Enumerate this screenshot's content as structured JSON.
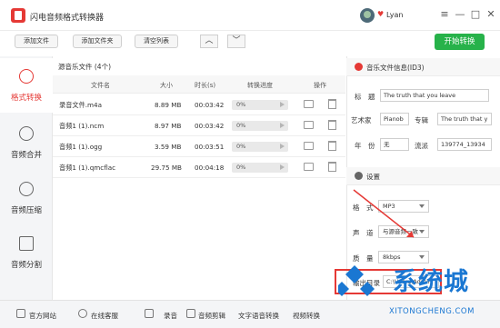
{
  "app": {
    "title": "闪电音频格式转换器",
    "user_name": "Lyan"
  },
  "window_controls": {
    "menu": "≡",
    "minimize": "—",
    "maximize": "□",
    "close": "✕"
  },
  "toolbar": {
    "add_file": "添加文件",
    "add_folder": "添加文件夹",
    "clear_list": "清空列表",
    "up": "︿",
    "down": "﹀",
    "start": "开始转换"
  },
  "nav": [
    {
      "label": "格式转换",
      "icon": "refresh-icon",
      "active": true
    },
    {
      "label": "音频合并",
      "icon": "merge-icon",
      "active": false
    },
    {
      "label": "音频压缩",
      "icon": "compress-icon",
      "active": false
    },
    {
      "label": "音频分割",
      "icon": "split-icon",
      "active": false
    }
  ],
  "files": {
    "title": "源音乐文件 (4个)",
    "columns": [
      "文件名",
      "大小",
      "时长(s)",
      "转换进度",
      "操作"
    ],
    "rows": [
      {
        "name": "录音文件.m4a",
        "size": "8.89 MB",
        "duration": "00:03:42",
        "progress": "0%"
      },
      {
        "name": "音频1 (1).ncm",
        "size": "8.97 MB",
        "duration": "00:03:42",
        "progress": "0%"
      },
      {
        "name": "音频1 (1).ogg",
        "size": "3.59 MB",
        "duration": "00:03:51",
        "progress": "0%"
      },
      {
        "name": "音频1 (1).qmcflac",
        "size": "29.75 MB",
        "duration": "00:04:18",
        "progress": "0%"
      }
    ]
  },
  "id3": {
    "title": "音乐文件信息(ID3)",
    "title_label": "标　题",
    "title_value": "The truth that you leave",
    "artist_label": "艺术家",
    "artist_value": "Pianob",
    "album_label": "专辑",
    "album_value": "The truth that y",
    "year_label": "年　份",
    "year_value": "无",
    "genre_label": "流派",
    "genre_value": "139774_13934"
  },
  "settings": {
    "title": "设置",
    "format_label": "格　式",
    "format_value": "MP3",
    "channel_label": "声　道",
    "channel_value": "与源音频一致",
    "quality_label": "质　量",
    "quality_value": "8kbps",
    "output_label": "输出目录",
    "output_value": "C:\\Users\\Admin"
  },
  "bottom": {
    "website": "官方网站",
    "support": "在线客服",
    "record": "录音",
    "cut": "音频剪辑",
    "tts": "文字语音转换",
    "video": "视频转换"
  },
  "watermark": {
    "text": "系统城",
    "sub": "XITONGCHENG.COM"
  },
  "colors": {
    "accent": "#e53935",
    "start": "#27b24a",
    "watermark": "#1a77d2"
  }
}
